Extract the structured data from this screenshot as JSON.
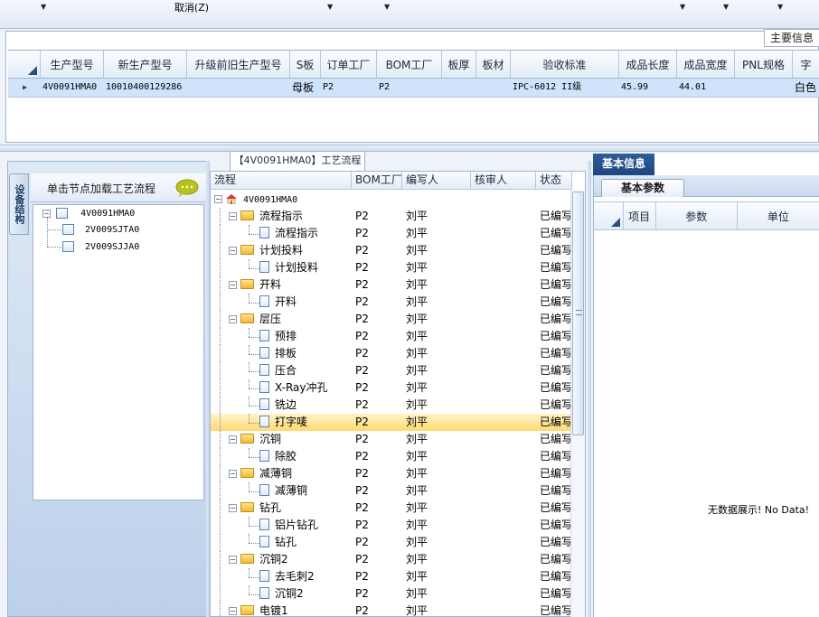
{
  "toolbar": {
    "cancel_label": "取消(Z)"
  },
  "main_panel": {
    "tab_label": "主要信息",
    "columns": [
      "生产型号",
      "新生产型号",
      "升级前旧生产型号",
      "S板",
      "订单工厂",
      "BOM工厂",
      "板厚",
      "板材",
      "验收标准",
      "成品长度",
      "成品宽度",
      "PNL规格",
      "字"
    ],
    "row": [
      "4V0091HMA0",
      "10010400129286",
      "",
      "母板",
      "P2",
      "P2",
      "",
      "",
      "IPC-6012 II级",
      "45.99",
      "44.01",
      "",
      "白色"
    ]
  },
  "left_panel": {
    "vertical_tab": "设备结构",
    "load_tip": "单击节点加载工艺流程",
    "tree": {
      "root": "4V0091HMA0",
      "children": [
        "2V009SJTA0",
        "2V009SJJA0"
      ]
    }
  },
  "flow_panel": {
    "tab_label": "【4V0091HMA0】工艺流程",
    "columns": [
      "流程",
      "BOM工厂",
      "编写人",
      "核审人",
      "状态"
    ],
    "root": "4V0091HMA0",
    "rows": [
      {
        "name": "流程指示",
        "level": 1,
        "bom": "P2",
        "author": "刘平",
        "reviewer": "",
        "status": "已编写"
      },
      {
        "name": "流程指示",
        "level": 2,
        "bom": "P2",
        "author": "刘平",
        "reviewer": "",
        "status": "已编写"
      },
      {
        "name": "计划投料",
        "level": 1,
        "bom": "P2",
        "author": "刘平",
        "reviewer": "",
        "status": "已编写"
      },
      {
        "name": "计划投料",
        "level": 2,
        "bom": "P2",
        "author": "刘平",
        "reviewer": "",
        "status": "已编写"
      },
      {
        "name": "开料",
        "level": 1,
        "bom": "P2",
        "author": "刘平",
        "reviewer": "",
        "status": "已编写"
      },
      {
        "name": "开料",
        "level": 2,
        "bom": "P2",
        "author": "刘平",
        "reviewer": "",
        "status": "已编写"
      },
      {
        "name": "层压",
        "level": 1,
        "bom": "P2",
        "author": "刘平",
        "reviewer": "",
        "status": "已编写"
      },
      {
        "name": "预排",
        "level": 2,
        "bom": "P2",
        "author": "刘平",
        "reviewer": "",
        "status": "已编写"
      },
      {
        "name": "排板",
        "level": 2,
        "bom": "P2",
        "author": "刘平",
        "reviewer": "",
        "status": "已编写"
      },
      {
        "name": "压合",
        "level": 2,
        "bom": "P2",
        "author": "刘平",
        "reviewer": "",
        "status": "已编写"
      },
      {
        "name": "X-Ray冲孔",
        "level": 2,
        "bom": "P2",
        "author": "刘平",
        "reviewer": "",
        "status": "已编写"
      },
      {
        "name": "铣边",
        "level": 2,
        "bom": "P2",
        "author": "刘平",
        "reviewer": "",
        "status": "已编写"
      },
      {
        "name": "打字唛",
        "level": 2,
        "bom": "P2",
        "author": "刘平",
        "reviewer": "",
        "status": "已编写",
        "selected": true
      },
      {
        "name": "沉铜",
        "level": 1,
        "bom": "P2",
        "author": "刘平",
        "reviewer": "",
        "status": "已编写"
      },
      {
        "name": "除胶",
        "level": 2,
        "bom": "P2",
        "author": "刘平",
        "reviewer": "",
        "status": "已编写"
      },
      {
        "name": "减薄铜",
        "level": 1,
        "bom": "P2",
        "author": "刘平",
        "reviewer": "",
        "status": "已编写"
      },
      {
        "name": "减薄铜",
        "level": 2,
        "bom": "P2",
        "author": "刘平",
        "reviewer": "",
        "status": "已编写"
      },
      {
        "name": "钻孔",
        "level": 1,
        "bom": "P2",
        "author": "刘平",
        "reviewer": "",
        "status": "已编写"
      },
      {
        "name": "铝片钻孔",
        "level": 2,
        "bom": "P2",
        "author": "刘平",
        "reviewer": "",
        "status": "已编写"
      },
      {
        "name": "钻孔",
        "level": 2,
        "bom": "P2",
        "author": "刘平",
        "reviewer": "",
        "status": "已编写"
      },
      {
        "name": "沉铜2",
        "level": 1,
        "bom": "P2",
        "author": "刘平",
        "reviewer": "",
        "status": "已编写"
      },
      {
        "name": "去毛刺2",
        "level": 2,
        "bom": "P2",
        "author": "刘平",
        "reviewer": "",
        "status": "已编写"
      },
      {
        "name": "沉铜2",
        "level": 2,
        "bom": "P2",
        "author": "刘平",
        "reviewer": "",
        "status": "已编写"
      },
      {
        "name": "电镀1",
        "level": 1,
        "bom": "P2",
        "author": "刘平",
        "reviewer": "",
        "status": "已编写"
      }
    ]
  },
  "right_panel": {
    "tab_label": "基本信息",
    "sub_tab_label": "基本参数",
    "columns": [
      "项目",
      "参数",
      "单位"
    ],
    "empty_text": "无数据展示! No Data!"
  }
}
